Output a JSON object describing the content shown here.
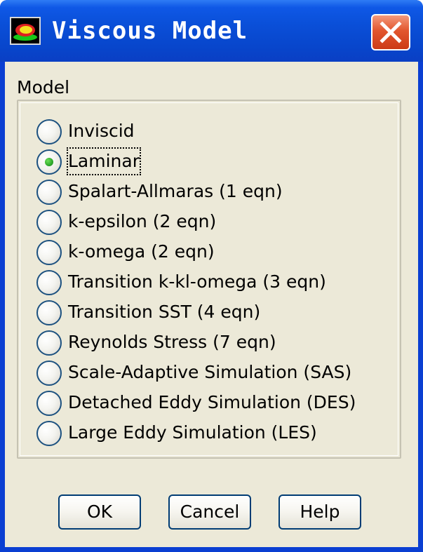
{
  "window": {
    "title": "Viscous Model",
    "icon": "fluent-app-icon",
    "close_icon": "close-x-icon",
    "titlebar_color": "#0a4fd8",
    "close_color": "#e2562e",
    "client_color": "#ece9d8"
  },
  "model_group": {
    "label": "Model",
    "selected_index": 1,
    "options": [
      {
        "label": "Inviscid",
        "selected": false
      },
      {
        "label": "Laminar",
        "selected": true
      },
      {
        "label": "Spalart-Allmaras (1 eqn)",
        "selected": false
      },
      {
        "label": "k-epsilon (2 eqn)",
        "selected": false
      },
      {
        "label": "k-omega (2 eqn)",
        "selected": false
      },
      {
        "label": "Transition k-kl-omega (3 eqn)",
        "selected": false
      },
      {
        "label": "Transition SST (4 eqn)",
        "selected": false
      },
      {
        "label": "Reynolds Stress (7 eqn)",
        "selected": false
      },
      {
        "label": "Scale-Adaptive Simulation (SAS)",
        "selected": false
      },
      {
        "label": "Detached Eddy Simulation (DES)",
        "selected": false
      },
      {
        "label": "Large Eddy Simulation (LES)",
        "selected": false
      }
    ]
  },
  "buttons": {
    "ok": "OK",
    "cancel": "Cancel",
    "help": "Help"
  }
}
